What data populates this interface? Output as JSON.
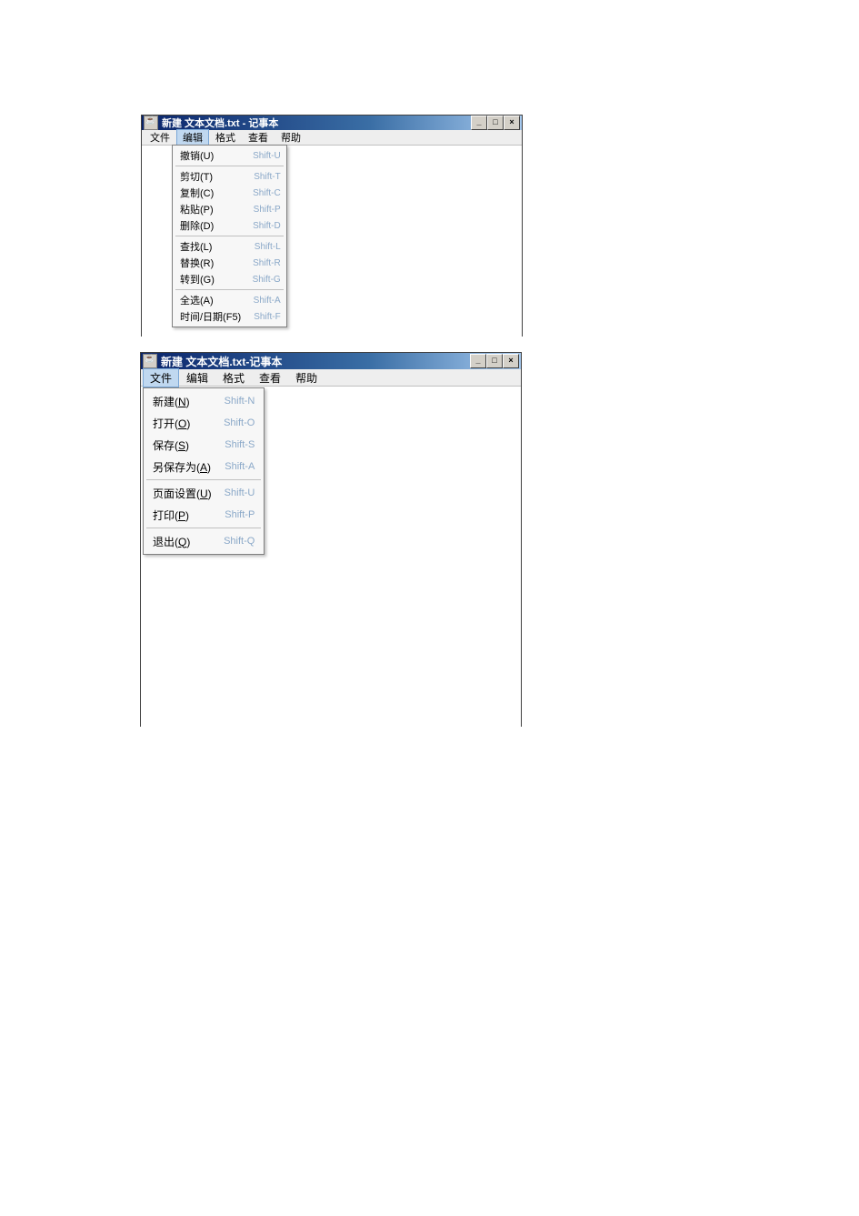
{
  "window1": {
    "title": "新建 文本文档.txt - 记事本",
    "menubar": [
      "文件",
      "编辑",
      "格式",
      "查看",
      "帮助"
    ],
    "selected_menu_index": 1,
    "dropdown": {
      "groups": [
        [
          {
            "label": "撤销(U)",
            "shortcut": "Shift-U"
          }
        ],
        [
          {
            "label": "剪切(T)",
            "shortcut": "Shift-T"
          },
          {
            "label": "复制(C)",
            "shortcut": "Shift-C"
          },
          {
            "label": "粘贴(P)",
            "shortcut": "Shift-P"
          },
          {
            "label": "删除(D)",
            "shortcut": "Shift-D"
          }
        ],
        [
          {
            "label": "查找(L)",
            "shortcut": "Shift-L"
          },
          {
            "label": "替换(R)",
            "shortcut": "Shift-R"
          },
          {
            "label": "转到(G)",
            "shortcut": "Shift-G"
          }
        ],
        [
          {
            "label": "全选(A)",
            "shortcut": "Shift-A"
          },
          {
            "label": "时间/日期(F5)",
            "shortcut": "Shift-F"
          }
        ]
      ]
    }
  },
  "window2": {
    "title": "新建 文本文档.txt-记事本",
    "menubar": [
      "文件",
      "编辑",
      "格式",
      "查看",
      "帮助"
    ],
    "selected_menu_index": 0,
    "dropdown": {
      "groups": [
        [
          {
            "label_pre": "新建(",
            "mnemonic": "N",
            "label_post": ")",
            "shortcut": "Shift-N"
          },
          {
            "label_pre": "打开(",
            "mnemonic": "O",
            "label_post": ")",
            "shortcut": "Shift-O"
          },
          {
            "label_pre": "保存(",
            "mnemonic": "S",
            "label_post": ")",
            "shortcut": "Shift-S"
          },
          {
            "label_pre": "另保存为(",
            "mnemonic": "A",
            "label_post": ")",
            "shortcut": "Shift-A"
          }
        ],
        [
          {
            "label_pre": "页面设置(",
            "mnemonic": "U",
            "label_post": ")",
            "shortcut": "Shift-U"
          },
          {
            "label_pre": "打印(",
            "mnemonic": "P",
            "label_post": ")",
            "shortcut": "Shift-P"
          }
        ],
        [
          {
            "label_pre": "退出(",
            "mnemonic": "Q",
            "label_post": ")",
            "shortcut": "Shift-Q"
          }
        ]
      ]
    }
  },
  "win_controls": {
    "minimize": "_",
    "maximize": "□",
    "close": "×"
  }
}
